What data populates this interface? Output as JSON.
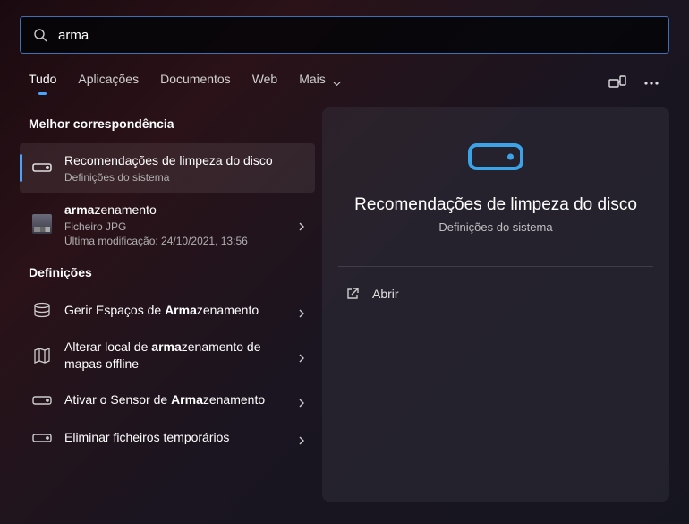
{
  "search": {
    "query": "arma"
  },
  "tabs": {
    "items": [
      "Tudo",
      "Aplicações",
      "Documentos",
      "Web",
      "Mais"
    ],
    "active_index": 0
  },
  "sections": {
    "best_match": "Melhor correspondência",
    "settings": "Definições"
  },
  "best_match": {
    "primary": {
      "title": "Recomendações de limpeza do disco",
      "subtitle": "Definições do sistema"
    },
    "file": {
      "title_html": "<b>arma</b>zenamento",
      "subtitle": "Ficheiro JPG",
      "meta": "Última modificação: 24/10/2021, 13:56"
    }
  },
  "settings_results": [
    {
      "title_html": "Gerir Espaços de <b>Arma</b>zenamento",
      "icon": "stack"
    },
    {
      "title_html": "Alterar local de <b>arma</b>zenamento de mapas offline",
      "icon": "map"
    },
    {
      "title_html": "Ativar o Sensor de <b>Arma</b>zenamento",
      "icon": "drive"
    },
    {
      "title_html": "Eliminar ficheiros temporários",
      "icon": "drive"
    }
  ],
  "detail": {
    "title": "Recomendações de limpeza do disco",
    "subtitle": "Definições do sistema",
    "actions": {
      "open": "Abrir"
    }
  }
}
